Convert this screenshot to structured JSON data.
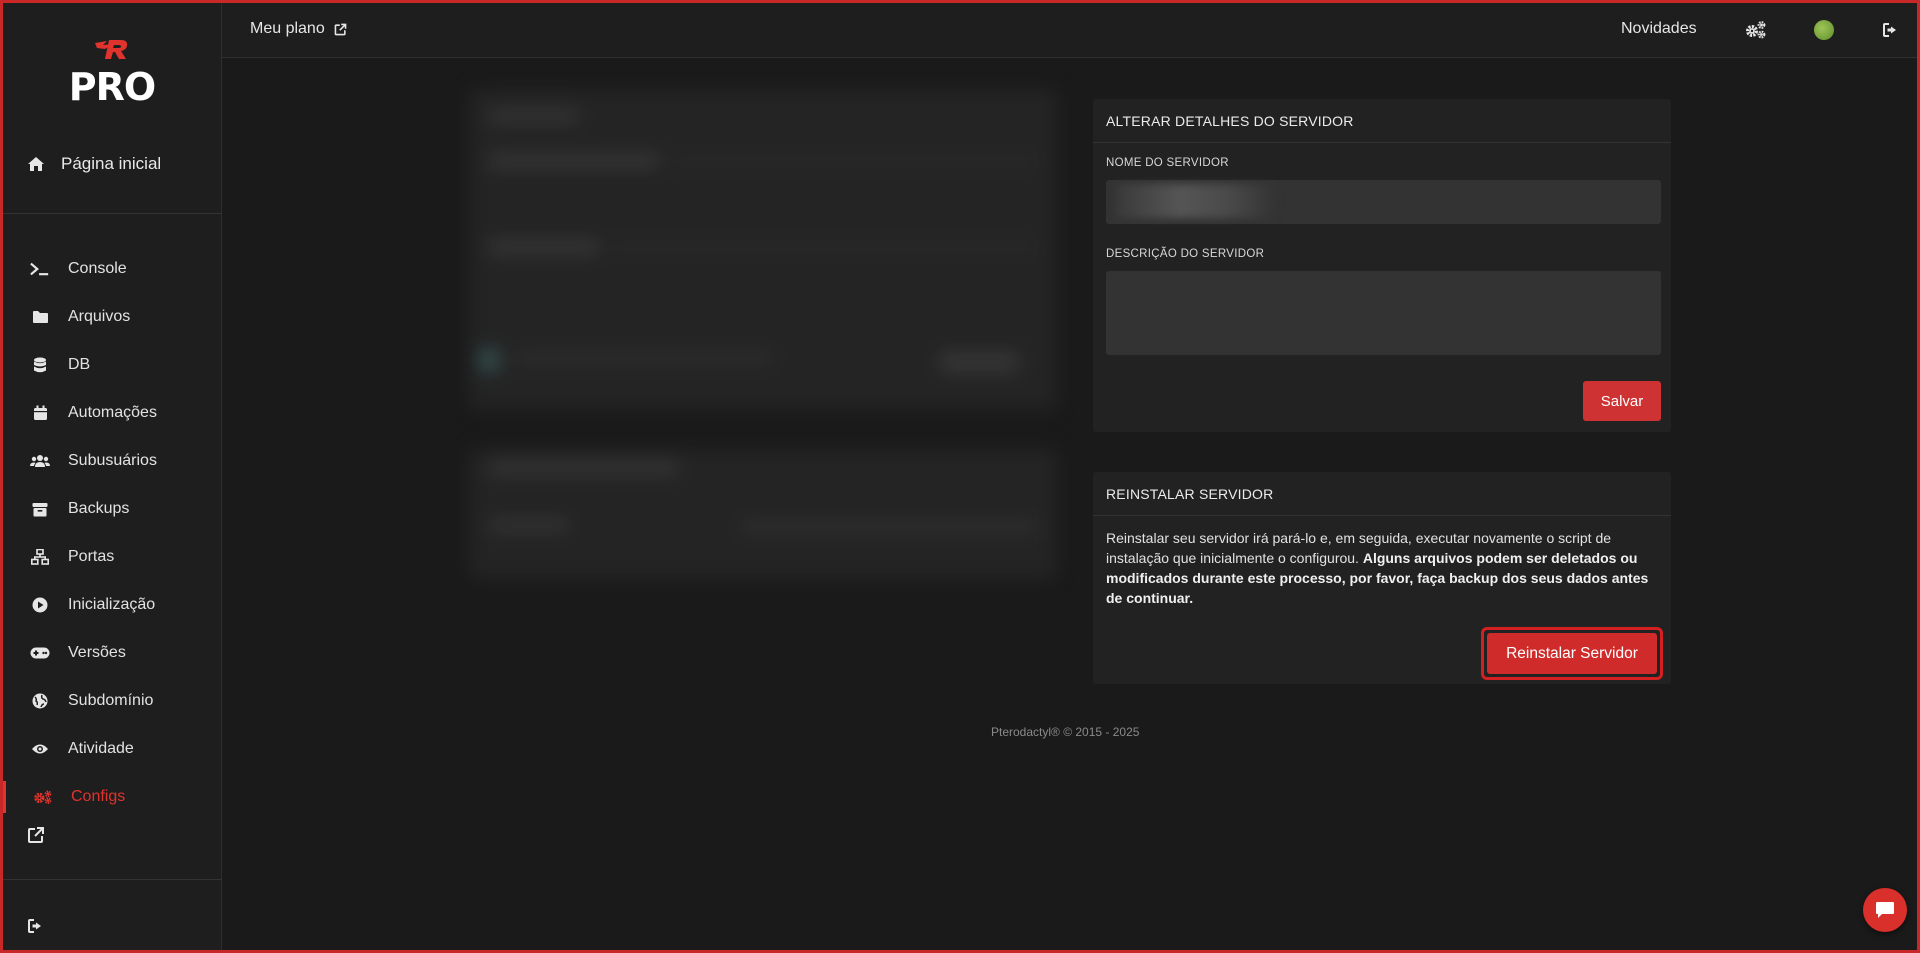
{
  "brand": {
    "logo_text": "PRO",
    "accent": "#e0332e"
  },
  "topbar": {
    "plan_label": "Meu plano",
    "news_label": "Novidades"
  },
  "sidebar": {
    "home_label": "Página inicial",
    "items": [
      {
        "label": "Console",
        "icon": "terminal-icon",
        "active": false
      },
      {
        "label": "Arquivos",
        "icon": "folder-icon",
        "active": false
      },
      {
        "label": "DB",
        "icon": "database-icon",
        "active": false
      },
      {
        "label": "Automações",
        "icon": "calendar-icon",
        "active": false
      },
      {
        "label": "Subusuários",
        "icon": "users-icon",
        "active": false
      },
      {
        "label": "Backups",
        "icon": "archive-icon",
        "active": false
      },
      {
        "label": "Portas",
        "icon": "network-icon",
        "active": false
      },
      {
        "label": "Inicialização",
        "icon": "play-circle-icon",
        "active": false
      },
      {
        "label": "Versões",
        "icon": "gamepad-icon",
        "active": false
      },
      {
        "label": "Subdomínio",
        "icon": "globe-icon",
        "active": false
      },
      {
        "label": "Atividade",
        "icon": "eye-icon",
        "active": false
      },
      {
        "label": "Configs",
        "icon": "gears-icon",
        "active": true
      }
    ]
  },
  "server_details": {
    "title": "ALTERAR DETALHES DO SERVIDOR",
    "name_label": "NOME DO SERVIDOR",
    "description_label": "DESCRIÇÃO DO SERVIDOR",
    "description_value": "",
    "save_label": "Salvar"
  },
  "reinstall": {
    "title": "REINSTALAR SERVIDOR",
    "text_normal": "Reinstalar seu servidor irá pará-lo e, em seguida, executar novamente o script de instalação que inicialmente o configurou. ",
    "text_bold": "Alguns arquivos podem ser deletados ou modificados durante este processo, por favor, faça backup dos seus dados antes de continuar.",
    "button_label": "Reinstalar Servidor"
  },
  "footer": {
    "text": "Pterodactyl® © 2015 - 2025"
  }
}
